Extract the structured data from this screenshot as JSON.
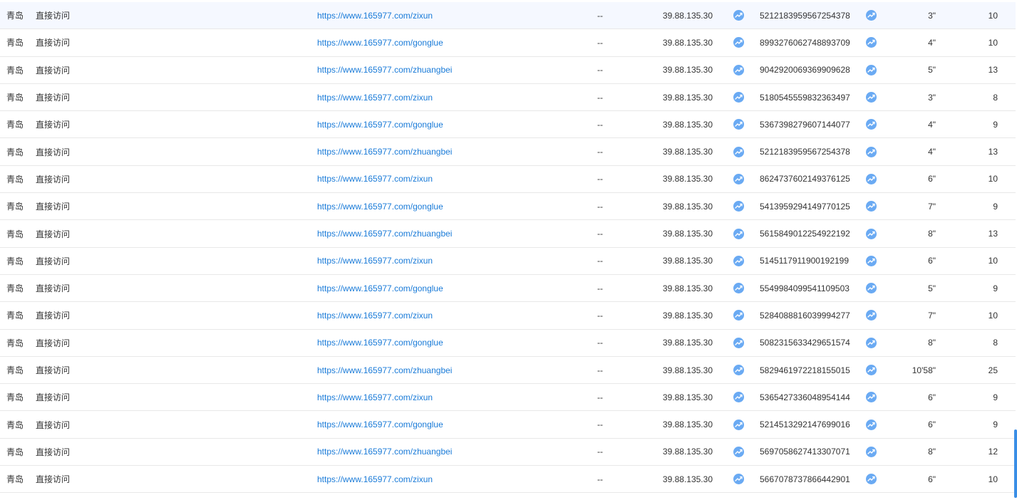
{
  "icons": {
    "trend": "trend-chart-icon"
  },
  "colors": {
    "link": "#1a7bd8",
    "icon": "#6aaaf3",
    "scrollbar": "#3a8ee6",
    "highlight_row": "#f5f8ff"
  },
  "rows": [
    {
      "city": "青岛",
      "source": "直接访问",
      "url": "https://www.165977.com/zixun",
      "dash": "--",
      "ip": "39.88.135.30",
      "id": "5212183959567254378",
      "duration": "3\"",
      "pv": "10"
    },
    {
      "city": "青岛",
      "source": "直接访问",
      "url": "https://www.165977.com/gonglue",
      "dash": "--",
      "ip": "39.88.135.30",
      "id": "8993276062748893709",
      "duration": "4\"",
      "pv": "10"
    },
    {
      "city": "青岛",
      "source": "直接访问",
      "url": "https://www.165977.com/zhuangbei",
      "dash": "--",
      "ip": "39.88.135.30",
      "id": "9042920069369909628",
      "duration": "5\"",
      "pv": "13"
    },
    {
      "city": "青岛",
      "source": "直接访问",
      "url": "https://www.165977.com/zixun",
      "dash": "--",
      "ip": "39.88.135.30",
      "id": "5180545559832363497",
      "duration": "3\"",
      "pv": "8"
    },
    {
      "city": "青岛",
      "source": "直接访问",
      "url": "https://www.165977.com/gonglue",
      "dash": "--",
      "ip": "39.88.135.30",
      "id": "5367398279607144077",
      "duration": "4\"",
      "pv": "9"
    },
    {
      "city": "青岛",
      "source": "直接访问",
      "url": "https://www.165977.com/zhuangbei",
      "dash": "--",
      "ip": "39.88.135.30",
      "id": "5212183959567254378",
      "duration": "4\"",
      "pv": "13"
    },
    {
      "city": "青岛",
      "source": "直接访问",
      "url": "https://www.165977.com/zixun",
      "dash": "--",
      "ip": "39.88.135.30",
      "id": "8624737602149376125",
      "duration": "6\"",
      "pv": "10"
    },
    {
      "city": "青岛",
      "source": "直接访问",
      "url": "https://www.165977.com/gonglue",
      "dash": "--",
      "ip": "39.88.135.30",
      "id": "5413959294149770125",
      "duration": "7\"",
      "pv": "9"
    },
    {
      "city": "青岛",
      "source": "直接访问",
      "url": "https://www.165977.com/zhuangbei",
      "dash": "--",
      "ip": "39.88.135.30",
      "id": "5615849012254922192",
      "duration": "8\"",
      "pv": "13"
    },
    {
      "city": "青岛",
      "source": "直接访问",
      "url": "https://www.165977.com/zixun",
      "dash": "--",
      "ip": "39.88.135.30",
      "id": "5145117911900192199",
      "duration": "6\"",
      "pv": "10"
    },
    {
      "city": "青岛",
      "source": "直接访问",
      "url": "https://www.165977.com/gonglue",
      "dash": "--",
      "ip": "39.88.135.30",
      "id": "5549984099541109503",
      "duration": "5\"",
      "pv": "9"
    },
    {
      "city": "青岛",
      "source": "直接访问",
      "url": "https://www.165977.com/zixun",
      "dash": "--",
      "ip": "39.88.135.30",
      "id": "5284088816039994277",
      "duration": "7\"",
      "pv": "10"
    },
    {
      "city": "青岛",
      "source": "直接访问",
      "url": "https://www.165977.com/gonglue",
      "dash": "--",
      "ip": "39.88.135.30",
      "id": "5082315633429651574",
      "duration": "8\"",
      "pv": "8"
    },
    {
      "city": "青岛",
      "source": "直接访问",
      "url": "https://www.165977.com/zhuangbei",
      "dash": "--",
      "ip": "39.88.135.30",
      "id": "5829461972218155015",
      "duration": "10'58\"",
      "pv": "25"
    },
    {
      "city": "青岛",
      "source": "直接访问",
      "url": "https://www.165977.com/zixun",
      "dash": "--",
      "ip": "39.88.135.30",
      "id": "5365427336048954144",
      "duration": "6\"",
      "pv": "9"
    },
    {
      "city": "青岛",
      "source": "直接访问",
      "url": "https://www.165977.com/gonglue",
      "dash": "--",
      "ip": "39.88.135.30",
      "id": "5214513292147699016",
      "duration": "6\"",
      "pv": "9"
    },
    {
      "city": "青岛",
      "source": "直接访问",
      "url": "https://www.165977.com/zhuangbei",
      "dash": "--",
      "ip": "39.88.135.30",
      "id": "5697058627413307071",
      "duration": "8\"",
      "pv": "12"
    },
    {
      "city": "青岛",
      "source": "直接访问",
      "url": "https://www.165977.com/zixun",
      "dash": "--",
      "ip": "39.88.135.30",
      "id": "5667078737866442901",
      "duration": "6\"",
      "pv": "10"
    }
  ]
}
